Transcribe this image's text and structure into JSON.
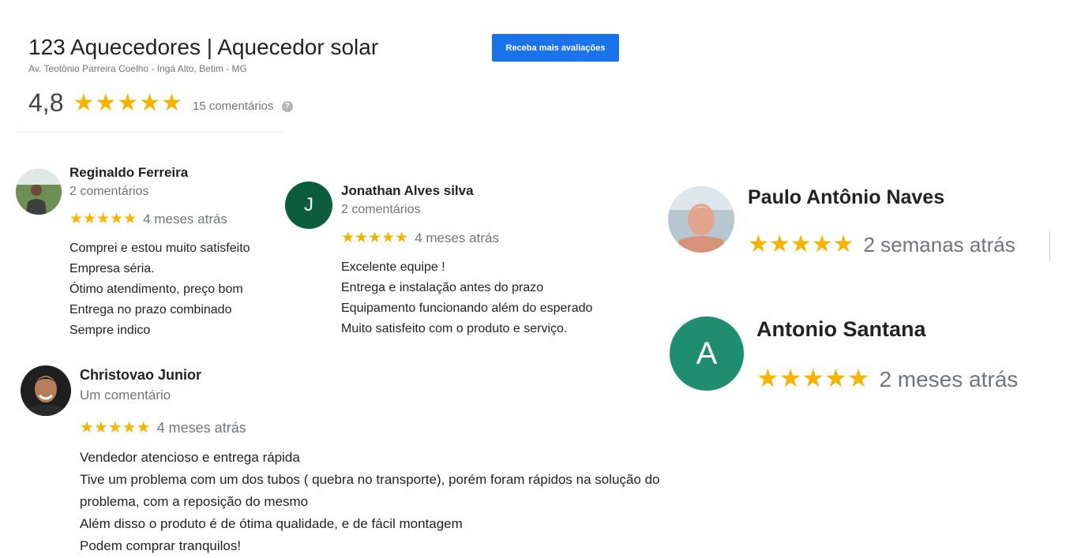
{
  "business": {
    "title": "123 Aquecedores | Aquecedor solar",
    "address": "Av. Teotônio Parreira Coelho - Ingá Alto, Betim - MG",
    "cta_label": "Receba mais avaliações",
    "rating": "4,8",
    "stars": "★★★★★",
    "review_count": "15 comentários",
    "help_glyph": "?"
  },
  "colors": {
    "star": "#f4b400",
    "cta": "#1a73e8",
    "avatar_j": "#0b5d3e",
    "avatar_a": "#1e8e6e"
  },
  "reviews": [
    {
      "name": "Reginaldo Ferreira",
      "count": "2 comentários",
      "stars": "★★★★★",
      "ago": "4 meses atrás",
      "text": [
        "Comprei e estou muito satisfeito",
        "Empresa séria.",
        "Ótimo atendimento, preço bom",
        "Entrega no prazo combinado",
        "Sempre  indico"
      ]
    },
    {
      "name": "Jonathan Alves silva",
      "initial": "J",
      "count": "2 comentários",
      "stars": "★★★★★",
      "ago": "4 meses atrás",
      "text": [
        "Excelente equipe !",
        "Entrega e instalação antes do prazo",
        "Equipamento funcionando além do esperado",
        "Muito satisfeito com o produto e serviço."
      ]
    },
    {
      "name": "Paulo Antônio Naves",
      "stars": "★★★★★",
      "ago": "2 semanas atrás"
    },
    {
      "name": "Antonio Santana",
      "initial": "A",
      "stars": "★★★★★",
      "ago": "2 meses atrás"
    },
    {
      "name": "Christovao Junior",
      "count": "Um comentário",
      "stars": "★★★★★",
      "ago": "4 meses atrás",
      "text": [
        "Vendedor atencioso e entrega rápida",
        "Tive um problema com um dos tubos ( quebra no transporte), porém foram rápidos na solução do",
        "problema, com a reposição do mesmo",
        "Além disso o produto é de ótima qualidade, e de fácil montagem",
        "Podem comprar tranquilos!"
      ]
    }
  ]
}
